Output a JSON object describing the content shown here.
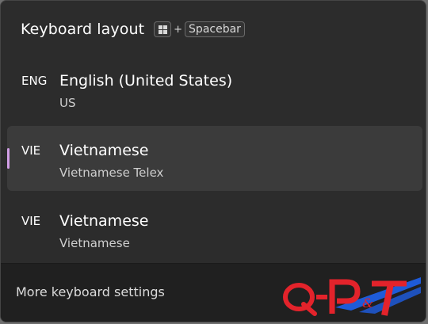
{
  "header": {
    "title": "Keyboard layout",
    "shortcut_plus": "+",
    "shortcut_key": "Spacebar"
  },
  "layouts": [
    {
      "code": "ENG",
      "name": "English (United States)",
      "sub": "US",
      "selected": false
    },
    {
      "code": "VIE",
      "name": "Vietnamese",
      "sub": "Vietnamese Telex",
      "selected": true
    },
    {
      "code": "VIE",
      "name": "Vietnamese",
      "sub": "Vietnamese",
      "selected": false
    }
  ],
  "footer": {
    "link": "More keyboard settings"
  },
  "watermark": {
    "text": "Q-P&T"
  },
  "colors": {
    "selection_indicator": "#d19ee6",
    "logo_red": "#e3232b",
    "logo_blue": "#1e5bd8"
  }
}
